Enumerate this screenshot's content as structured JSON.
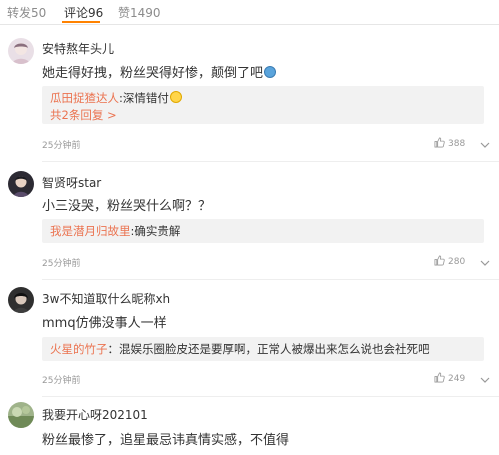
{
  "tabs": [
    {
      "label": "转发50"
    },
    {
      "label": "评论96"
    },
    {
      "label": "赞1490"
    }
  ],
  "comments": [
    {
      "user": "安特熬年头儿",
      "text": "她走得好拽，粉丝哭得好惨，颠倒了吧",
      "reply": {
        "user": "瓜田捉猹达人",
        "sep": ":",
        "text": "深情错付",
        "more": "共2条回复"
      },
      "time": "25分钟前",
      "likes": "388"
    },
    {
      "user": "智贤呀star",
      "text": "小三没哭，粉丝哭什么啊？？",
      "reply": {
        "user": "我是潜月归故里",
        "sep": ":",
        "text": "确实贵解"
      },
      "time": "25分钟前",
      "likes": "280"
    },
    {
      "user": "3w不知道取什么昵称xh",
      "text": "mmq仿佛没事人一样",
      "reply": {
        "user": "火星的竹子",
        "sep": "：",
        "text": "混娱乐圈脸皮还是要厚啊，正常人被爆出来怎么说也会社死吧"
      },
      "time": "25分钟前",
      "likes": "249"
    },
    {
      "user": "我要开心呀202101",
      "text": "粉丝最惨了，追星最忌讳真情实感，不值得"
    }
  ],
  "colors": {
    "accent": "#ff8200",
    "link": "#eb7350",
    "reply_bg": "#f2f2f2"
  },
  "icons": [
    "thumbs-up-icon",
    "chevron-down-icon"
  ]
}
